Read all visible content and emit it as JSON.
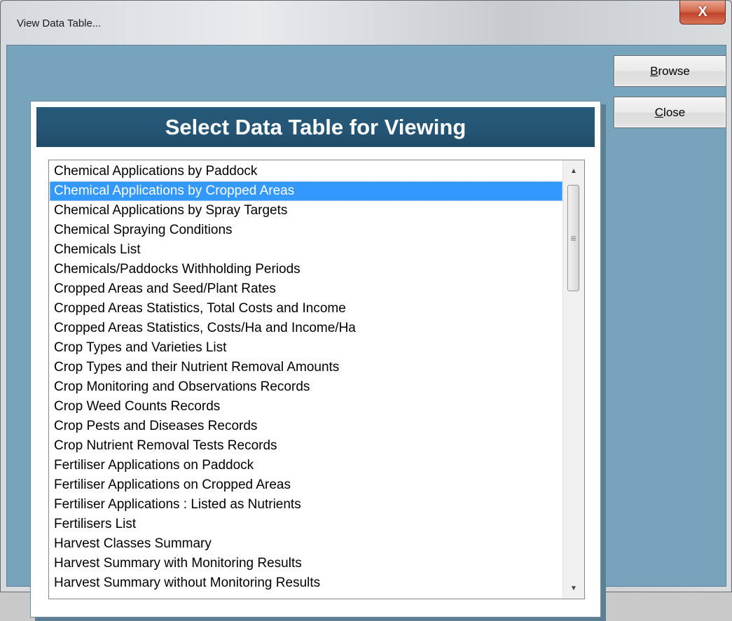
{
  "window": {
    "title": "View Data Table...",
    "close_glyph": "X"
  },
  "panel": {
    "heading": "Select Data Table for Viewing"
  },
  "list": {
    "selected_index": 1,
    "items": [
      "Chemical Applications by Paddock",
      "Chemical Applications by Cropped Areas",
      "Chemical Applications by Spray Targets",
      "Chemical Spraying Conditions",
      "Chemicals List",
      "Chemicals/Paddocks Withholding Periods",
      "Cropped Areas and Seed/Plant Rates",
      "Cropped Areas Statistics, Total Costs and Income",
      "Cropped Areas Statistics, Costs/Ha and Income/Ha",
      "Crop Types and Varieties List",
      "Crop Types and their Nutrient Removal Amounts",
      "Crop Monitoring and Observations Records",
      "Crop Weed Counts Records",
      "Crop Pests and Diseases Records",
      "Crop Nutrient Removal Tests Records",
      "Fertiliser Applications on Paddock",
      "Fertiliser Applications on Cropped Areas",
      "Fertiliser Applications : Listed as Nutrients",
      "Fertilisers List",
      "Harvest Classes Summary",
      "Harvest Summary with Monitoring Results",
      "Harvest Summary without Monitoring Results"
    ]
  },
  "buttons": {
    "browse": {
      "accel": "B",
      "rest": "rowse"
    },
    "close": {
      "accel": "C",
      "rest": "lose"
    }
  },
  "colors": {
    "client_bg": "#78a3bd",
    "header_bg": "#245574",
    "selection": "#3399ff"
  }
}
